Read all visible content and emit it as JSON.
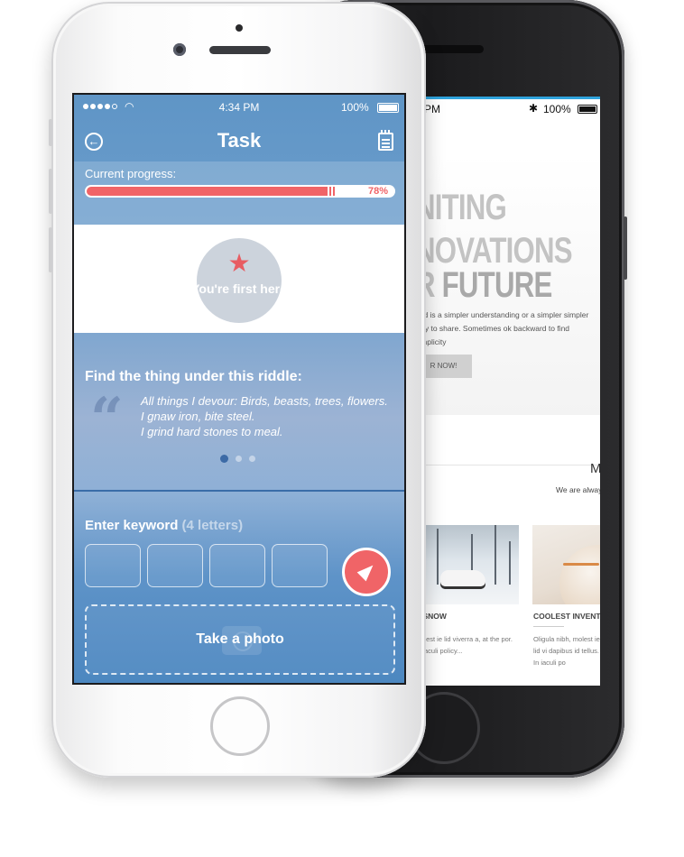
{
  "back_phone": {
    "status": {
      "time": "1 PM",
      "bluetooth_icon": "bluetooth-icon",
      "battery_text": "100%"
    },
    "hero": {
      "line1": "NITING",
      "line2": "NOVATIONS",
      "line3_prefix": "R ",
      "line3_bold": "FUTURE",
      "paragraph": "end is a simpler understanding or a simpler simpler way to share. Sometimes ok backward to find simplicity",
      "button_label": "R NOW!"
    },
    "section": {
      "heading_fragment": "M",
      "subtext": "We are alway"
    },
    "cards": [
      {
        "title": "N SNOW",
        "text": "molest ie lid viverra a, at the por. In iaculi policy..."
      },
      {
        "title": "COOLEST INVENT",
        "text": "Oligula nibh, molest ie lid vi dapibus id tellus. In iaculi po"
      }
    ]
  },
  "front_phone": {
    "status": {
      "time": "4:34 PM",
      "battery_text": "100%",
      "signal_dots_filled": 4,
      "signal_dots_total": 5,
      "wifi_icon": "wifi-icon"
    },
    "nav": {
      "title": "Task",
      "back_icon": "back-arrow-icon",
      "notes_icon": "notepad-icon"
    },
    "progress": {
      "label": "Current progress:",
      "percent_text": "78%",
      "value": 0.78
    },
    "badge": {
      "icon": "star-icon",
      "text": "You're first here"
    },
    "riddle": {
      "heading": "Find the thing under this riddle:",
      "quote_icon": "quote-icon",
      "lines": [
        "All things I devour: Birds, beasts, trees, flowers.",
        "I gnaw iron, bite steel.",
        "I grind hard stones to meal."
      ],
      "pager_total": 3,
      "pager_active": 0
    },
    "keyword": {
      "label": "Enter keyword",
      "hint": "(4 letters)",
      "box_count": 4,
      "send_icon": "send-arrow-icon"
    },
    "photo": {
      "label": "Take a photo",
      "icon": "camera-icon"
    }
  },
  "colors": {
    "accent_red": "#f06467",
    "screen_blue": "#5f95c6",
    "back_accent_blue": "#2fa3dc"
  }
}
